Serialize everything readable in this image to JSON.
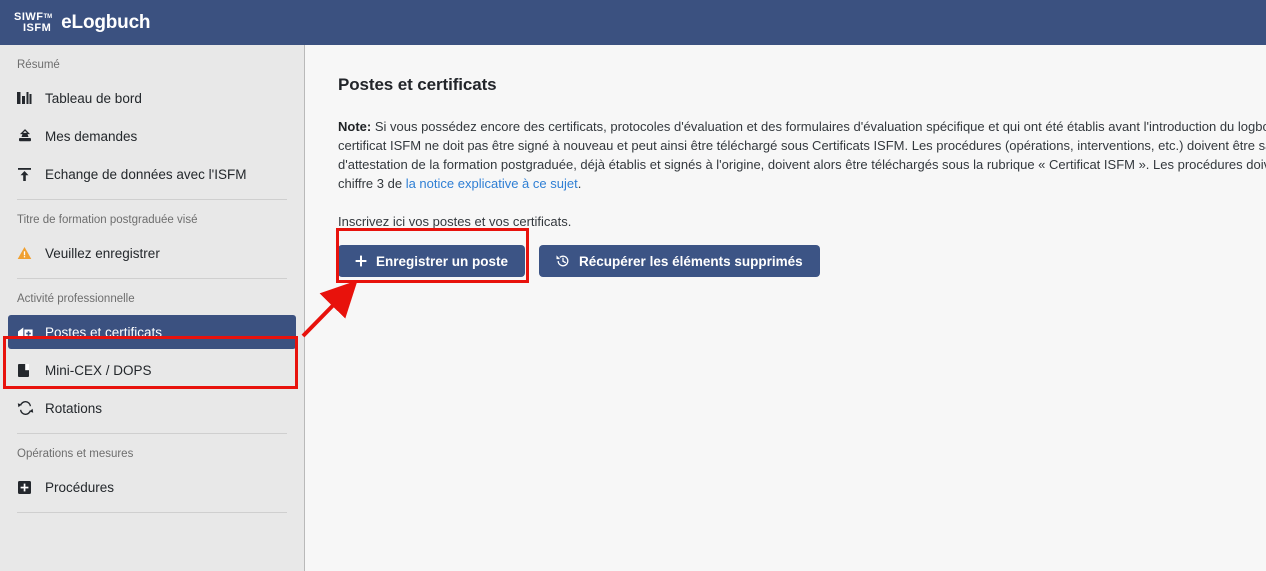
{
  "header": {
    "logo_line1": "SIWF",
    "logo_tm": "TM",
    "logo_line2": "ISFM",
    "app_name": "eLogbuch"
  },
  "sidebar": {
    "sections": [
      {
        "label": "Résumé",
        "items": [
          {
            "label": "Tableau de bord",
            "icon": "bar-chart-icon",
            "active": false
          },
          {
            "label": "Mes demandes",
            "icon": "inbox-stamp-icon",
            "active": false
          },
          {
            "label": "Echange de données avec l'ISFM",
            "icon": "upload-icon",
            "active": false
          }
        ]
      },
      {
        "label": "Titre de formation postgraduée visé",
        "items": [
          {
            "label": "Veuillez enregistrer",
            "icon": "warning-triangle-icon",
            "active": false
          }
        ]
      },
      {
        "label": "Activité professionnelle",
        "items": [
          {
            "label": "Postes et certificats",
            "icon": "hospital-icon",
            "active": true
          },
          {
            "label": "Mini-CEX / DOPS",
            "icon": "bookmark-icon",
            "active": false
          },
          {
            "label": "Rotations",
            "icon": "refresh-cycle-icon",
            "active": false
          }
        ]
      },
      {
        "label": "Opérations et mesures",
        "items": [
          {
            "label": "Procédures",
            "icon": "plus-square-icon",
            "active": false
          }
        ]
      }
    ]
  },
  "main": {
    "page_title": "Postes et certificats",
    "note": {
      "prefix_bold": "Note:",
      "line1": " Si vous possédez encore des certificats, protocoles d'évaluation et des formulaires d'évaluation spécifique et qui ont été établis avant l'introduction du logbook,",
      "line2": "certificat ISFM ne doit pas être signé à nouveau et peut ainsi être téléchargé sous Certificats ISFM. Les procédures (opérations, interventions, etc.) doivent être saisies",
      "line3": "d'attestation de la formation postgraduée, déjà établis et signés à l'origine, doivent alors être téléchargés sous la rubrique « Certificat ISFM ». Les procédures doivent",
      "line4_prefix": "chiffre 3 de ",
      "line4_link": "la notice explicative à ce sujet",
      "line4_suffix": "."
    },
    "instruction": "Inscrivez ici vos postes et vos certificats.",
    "buttons": [
      {
        "label": "Enregistrer un poste",
        "icon": "plus-icon"
      },
      {
        "label": "Récupérer les éléments supprimés",
        "icon": "history-restore-icon"
      }
    ]
  },
  "annotations": {
    "highlight_color": "#e8120c",
    "arrow_from": "sidebar-item-postes-et-certificats",
    "arrow_to": "enregistrer-un-poste-button"
  },
  "colors": {
    "brand_blue": "#3b5180",
    "button_blue": "#3c5485",
    "sidebar_bg": "#e8e8e8",
    "content_bg": "#f7f7f7",
    "link_blue": "#2f7fd4",
    "warning_orange": "#f0a030"
  }
}
